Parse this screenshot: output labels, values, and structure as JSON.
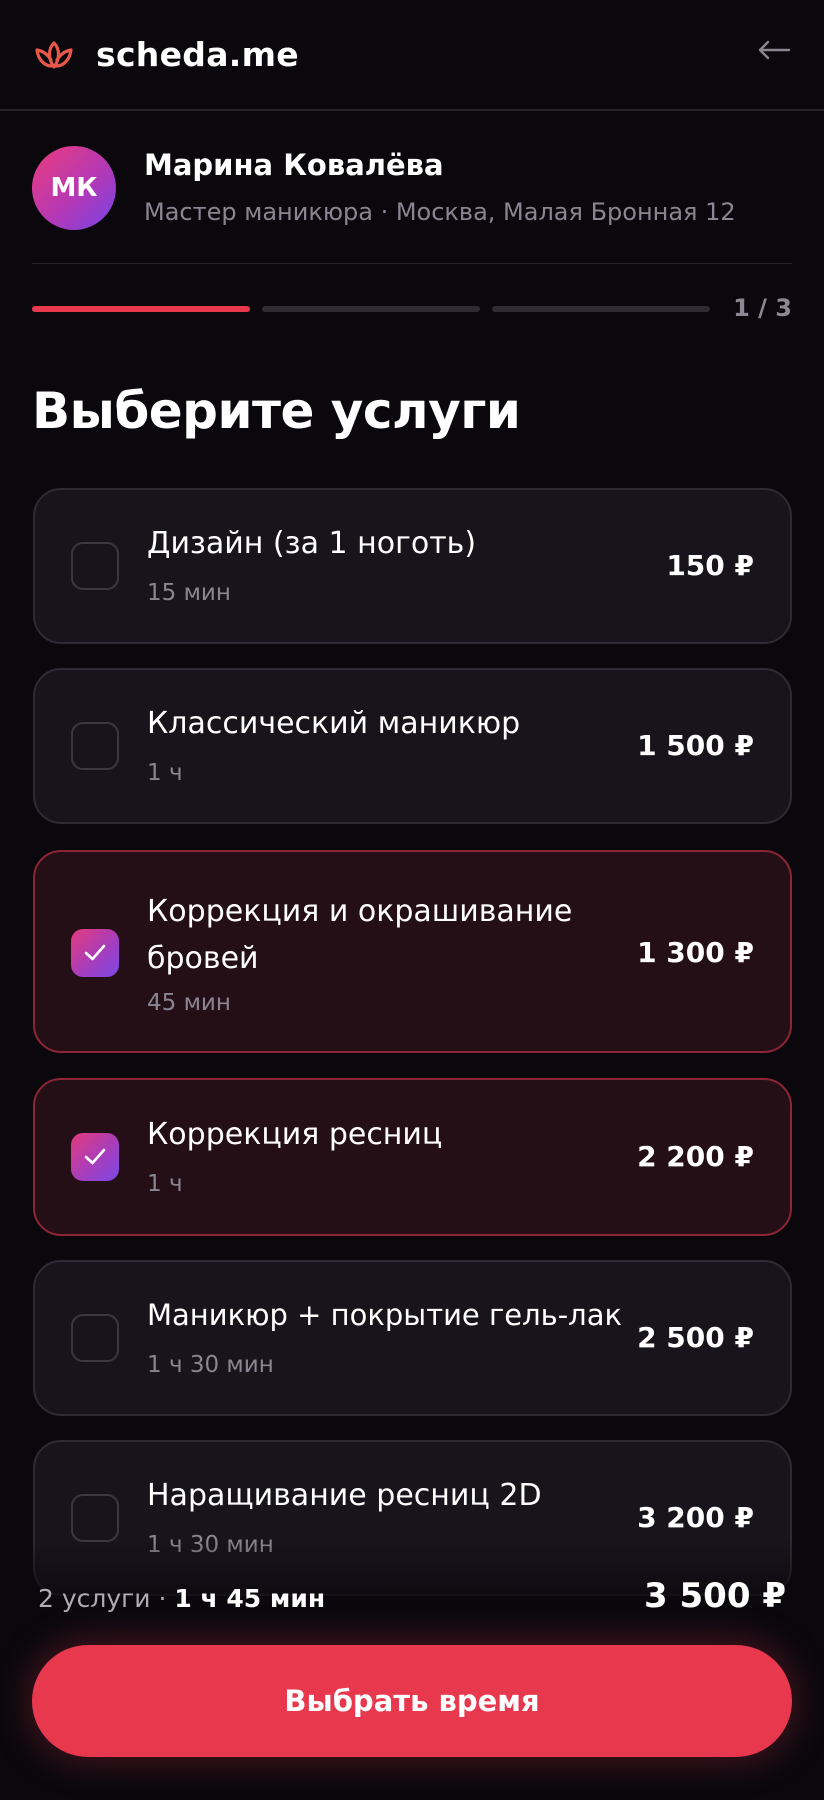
{
  "header": {
    "brand": "scheda.me",
    "logo_icon": "lotus-icon",
    "back_icon": "arrow-left-icon"
  },
  "master": {
    "initials": "МК",
    "name": "Марина Ковалёва",
    "subtitle": "Мастер маникюра · Москва, Малая Бронная 12"
  },
  "progress": {
    "current": 1,
    "total": 3,
    "label": "1 / 3"
  },
  "page_title": "Выберите услуги",
  "services": [
    {
      "name": "Дизайн (за 1 ноготь)",
      "duration": "15 мин",
      "price": "150 ₽",
      "selected": false
    },
    {
      "name": "Классический маникюр",
      "duration": "1 ч",
      "price": "1 500 ₽",
      "selected": false
    },
    {
      "name": "Коррекция и окрашивание бровей",
      "duration": "45 мин",
      "price": "1 300 ₽",
      "selected": true
    },
    {
      "name": "Коррекция ресниц",
      "duration": "1 ч",
      "price": "2 200 ₽",
      "selected": true
    },
    {
      "name": "Маникюр + покрытие гель-лак",
      "duration": "1 ч 30 мин",
      "price": "2 500 ₽",
      "selected": false
    },
    {
      "name": "Наращивание ресниц 2D",
      "duration": "1 ч 30 мин",
      "price": "3 200 ₽",
      "selected": false
    }
  ],
  "summary": {
    "count": "2 услуги",
    "separator": "·",
    "duration": "1 ч 45 мин",
    "total": "3 500 ₽"
  },
  "cta": {
    "label": "Выбрать время"
  },
  "colors": {
    "accent": "#e8384e",
    "background": "#0a080d",
    "card": "#17151b",
    "card_selected": "#250f17",
    "muted": "#8a8592"
  }
}
